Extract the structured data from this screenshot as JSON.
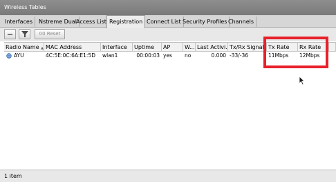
{
  "window": {
    "title": "Wireless Tables"
  },
  "tabs": [
    {
      "label": "Interfaces",
      "active": false
    },
    {
      "label": "Nstreme Dual",
      "active": false
    },
    {
      "label": "Access List",
      "active": false
    },
    {
      "label": "Registration",
      "active": true
    },
    {
      "label": "Connect List",
      "active": false
    },
    {
      "label": "Security Profiles",
      "active": false
    },
    {
      "label": "Channels",
      "active": false
    }
  ],
  "toolbar": {
    "remove_icon": "minus-icon",
    "filter_icon": "filter-icon",
    "reset_label": "00 Reset"
  },
  "table": {
    "columns": [
      "Radio Name",
      "MAC Address",
      "Interface",
      "Uptime",
      "AP",
      "W...",
      "Last Activi...",
      "Tx/Rx Signal",
      "Tx Rate",
      "Rx Rate"
    ],
    "sort_indicator": "▲",
    "rows": [
      {
        "radio_name": "AYU",
        "mac": "4C:5E:0C:6A:E1:5D",
        "interface": "wlan1",
        "uptime": "00:00:03",
        "ap": "yes",
        "w": "no",
        "last_activity": "0.000",
        "signal": "-33/-36",
        "tx_rate": "11Mbps",
        "rx_rate": "12Mbps"
      }
    ]
  },
  "status": {
    "item_count": "1 item"
  },
  "colors": {
    "highlight": "#e8202a"
  }
}
